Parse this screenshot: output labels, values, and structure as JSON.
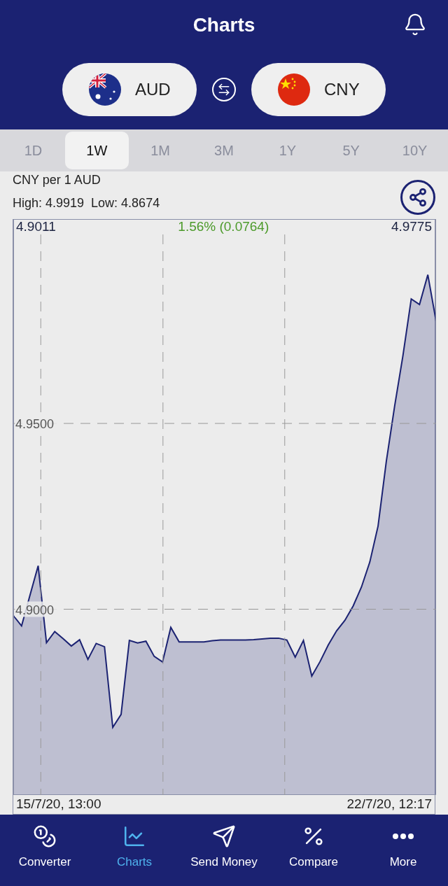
{
  "header": {
    "title": "Charts"
  },
  "currency_pair": {
    "from": {
      "code": "AUD",
      "kind": "au"
    },
    "to": {
      "code": "CNY",
      "kind": "cn"
    }
  },
  "tabs": [
    {
      "label": "1D",
      "selected": false
    },
    {
      "label": "1W",
      "selected": true
    },
    {
      "label": "1M",
      "selected": false
    },
    {
      "label": "3M",
      "selected": false
    },
    {
      "label": "1Y",
      "selected": false
    },
    {
      "label": "5Y",
      "selected": false
    },
    {
      "label": "10Y",
      "selected": false
    }
  ],
  "info": {
    "range": "High: 4.9919  Low: 4.8674"
  },
  "chart": {
    "start_value": "4.9011",
    "change": "1.56% (0.0764)",
    "end_value": "4.9775",
    "start_date": "15/7/20, 13:00",
    "end_date": "22/7/20, 12:17",
    "chart_data": {
      "type": "area",
      "categories": [
        null,
        null,
        null,
        null,
        null,
        null,
        null,
        null,
        null,
        null,
        null,
        null,
        null,
        null,
        null,
        null,
        null,
        null,
        null,
        null,
        null,
        null,
        null,
        null,
        null,
        null,
        null,
        null,
        null,
        null,
        null,
        null,
        null,
        null,
        null,
        null,
        null,
        null,
        null,
        null,
        null,
        null,
        null,
        null,
        null,
        null,
        null,
        null,
        null,
        null,
        null,
        null
      ],
      "series": [
        {
          "name": "CNY per 1 AUD",
          "color": "#1b2272",
          "values": [
            4.8983,
            4.8955,
            4.9037,
            4.9117,
            4.891,
            4.894,
            4.8921,
            4.8901,
            4.8918,
            4.8865,
            4.8908,
            4.8899,
            4.8682,
            4.8717,
            4.8916,
            4.8909,
            4.8914,
            4.8873,
            4.8858,
            4.8951,
            4.8912,
            4.8912,
            4.8912,
            4.8912,
            4.8915,
            4.8917,
            4.8917,
            4.8917,
            4.8917,
            4.8918,
            4.892,
            4.8922,
            4.8922,
            4.8917,
            4.8871,
            4.8916,
            4.882,
            4.8859,
            4.8904,
            4.8942,
            4.897,
            4.9009,
            4.906,
            4.9127,
            4.9224,
            4.9398,
            4.9547,
            4.9682,
            4.9835,
            4.982,
            4.99,
            4.9775
          ]
        }
      ],
      "ylim": [
        4.85,
        5.005
      ],
      "grid": true,
      "yticks": [
        {
          "value": 4.95,
          "label": "4.9500"
        },
        {
          "value": 4.9,
          "label": "4.9000"
        }
      ]
    }
  },
  "nav": [
    {
      "label": "Converter",
      "kind": "converter",
      "selected": false
    },
    {
      "label": "Charts",
      "kind": "charts",
      "selected": true
    },
    {
      "label": "Send Money",
      "kind": "send",
      "selected": false
    },
    {
      "label": "Compare",
      "kind": "compare",
      "selected": false
    },
    {
      "label": "More",
      "kind": "more",
      "selected": false
    }
  ]
}
